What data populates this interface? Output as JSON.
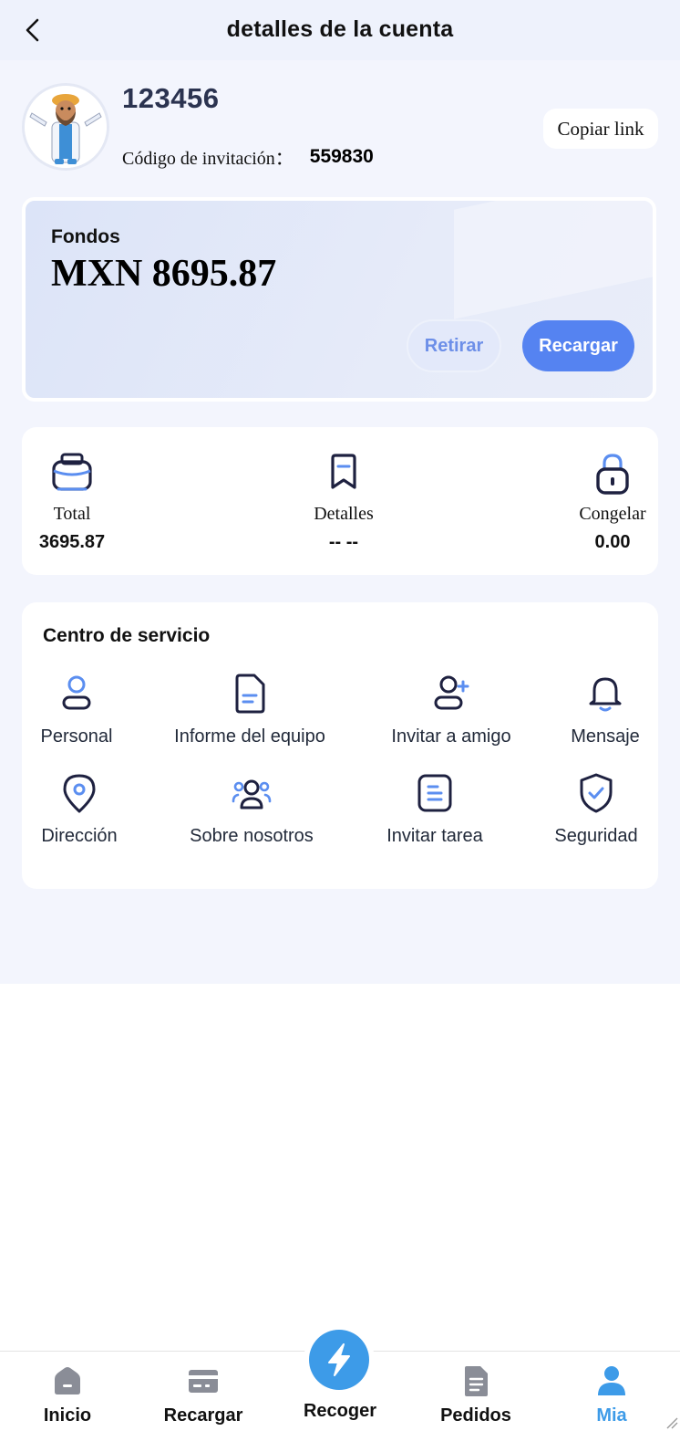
{
  "header": {
    "title": "detalles de la cuenta"
  },
  "profile": {
    "username": "123456",
    "invite_label": "Código de invitación：",
    "invite_code": "559830",
    "copy_label": "Copiar link"
  },
  "funds": {
    "label": "Fondos",
    "amount": "MXN 8695.87",
    "withdraw_label": "Retirar",
    "recharge_label": "Recargar"
  },
  "stats": [
    {
      "label": "Total",
      "value": "3695.87",
      "icon": "briefcase-icon"
    },
    {
      "label": "Detalles",
      "value": "-- --",
      "icon": "bookmark-icon"
    },
    {
      "label": "Congelar",
      "value": "0.00",
      "icon": "lock-icon"
    }
  ],
  "service": {
    "title": "Centro de servicio",
    "items": [
      {
        "label": "Personal",
        "icon": "user-icon"
      },
      {
        "label": "Informe del equipo",
        "icon": "document-icon"
      },
      {
        "label": "Invitar a amigo",
        "icon": "add-user-icon"
      },
      {
        "label": "Mensaje",
        "icon": "bell-icon"
      },
      {
        "label": "Dirección",
        "icon": "location-pin-icon"
      },
      {
        "label": "Sobre nosotros",
        "icon": "team-icon"
      },
      {
        "label": "Invitar tarea",
        "icon": "task-list-icon"
      },
      {
        "label": "Seguridad",
        "icon": "shield-check-icon"
      }
    ]
  },
  "tabbar": {
    "items": [
      {
        "label": "Inicio",
        "icon": "home-icon",
        "active": false
      },
      {
        "label": "Recargar",
        "icon": "card-icon",
        "active": false
      },
      {
        "label": "Recoger",
        "icon": "lightning-icon",
        "active": false
      },
      {
        "label": "Pedidos",
        "icon": "orders-icon",
        "active": false
      },
      {
        "label": "Mia",
        "icon": "person-icon",
        "active": true
      }
    ]
  },
  "colors": {
    "accent": "#5583f1",
    "tab_active": "#3d9be8",
    "icon_dark": "#1e2140",
    "icon_light": "#5b8ef0"
  }
}
